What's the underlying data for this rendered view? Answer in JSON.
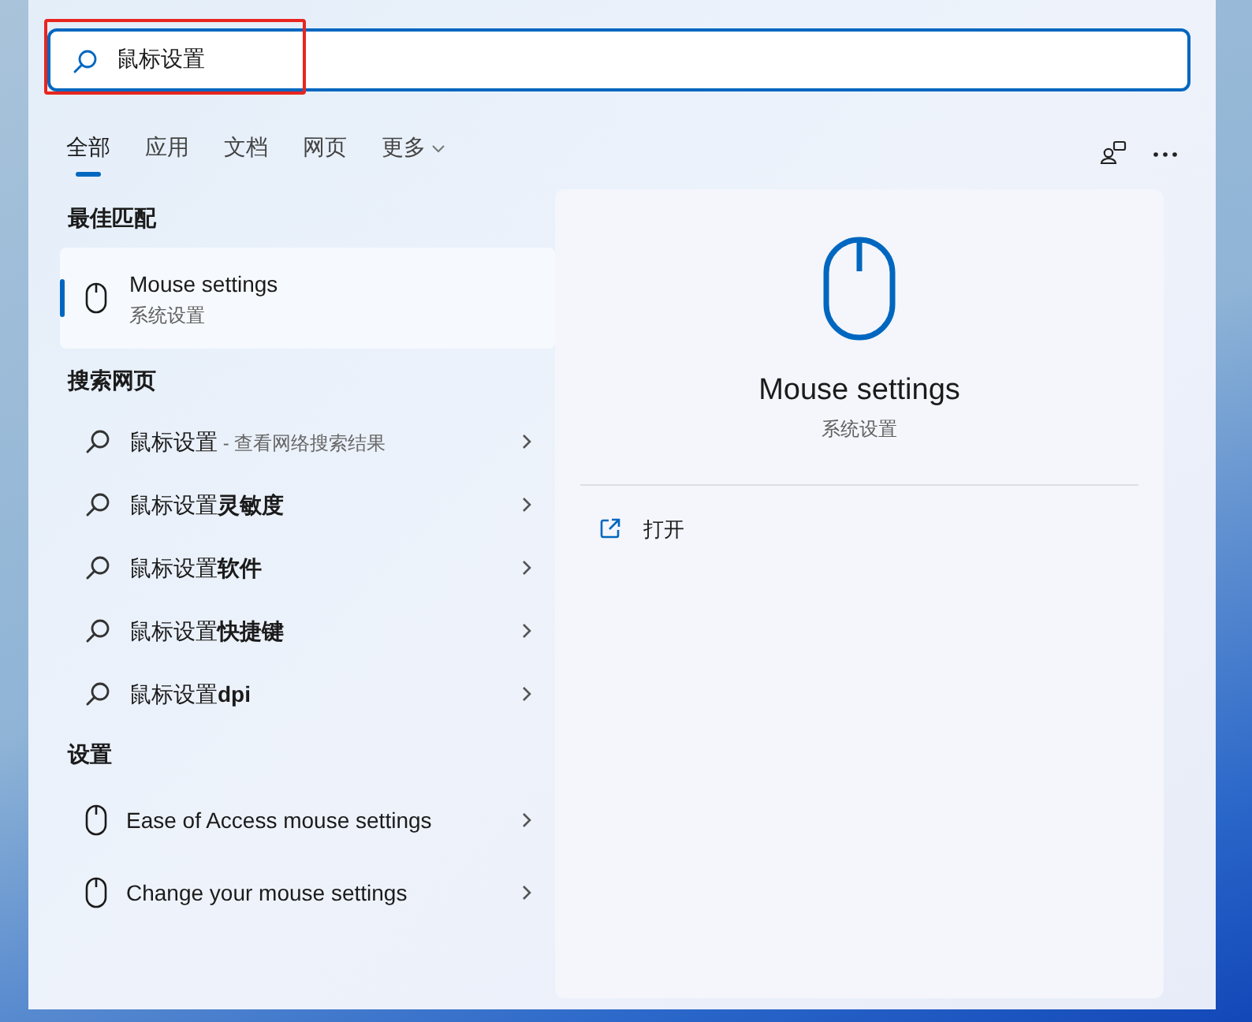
{
  "search": {
    "value": "鼠标设置"
  },
  "tabs": [
    {
      "label": "全部",
      "selected": true,
      "kind": "plain"
    },
    {
      "label": "应用",
      "selected": false,
      "kind": "plain"
    },
    {
      "label": "文档",
      "selected": false,
      "kind": "plain"
    },
    {
      "label": "网页",
      "selected": false,
      "kind": "plain"
    },
    {
      "label": "更多",
      "selected": false,
      "kind": "dropdown"
    }
  ],
  "best_match": {
    "heading": "最佳匹配",
    "item": {
      "title": "Mouse settings",
      "subtitle": "系统设置",
      "selected": true
    }
  },
  "web_search": {
    "heading": "搜索网页",
    "items": [
      {
        "text": "鼠标设置",
        "hint": "- 查看网络搜索结果"
      },
      {
        "text": "鼠标设置**灵敏度**"
      },
      {
        "text": "鼠标设置**软件**"
      },
      {
        "text": "鼠标设置**快捷键**"
      },
      {
        "text": "鼠标设置**dpi**"
      }
    ]
  },
  "settings": {
    "heading": "设置",
    "items": [
      {
        "title": "Ease of Access mouse settings"
      },
      {
        "title": "Change your mouse settings"
      }
    ]
  },
  "detail": {
    "title": "Mouse settings",
    "subtitle": "系统设置",
    "actions": [
      {
        "label": "打开"
      }
    ]
  }
}
